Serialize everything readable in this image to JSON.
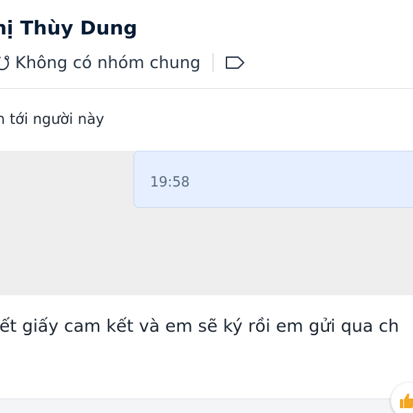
{
  "header": {
    "contact_name": "hị Thùy Dung",
    "group_status": "Không có nhóm chung",
    "group_icon": "group-circle-icon",
    "tag_icon": "tag-label-icon"
  },
  "banner": {
    "text": "n tới người này"
  },
  "chat": {
    "messages": [
      {
        "time": "19:58"
      }
    ]
  },
  "composer": {
    "draft_text": "iết giấy cam kết và em sẽ ký rồi em gửi qua ch"
  },
  "quick_reaction": {
    "icon": "thumbs-up-icon"
  },
  "colors": {
    "header_text": "#081c36",
    "bubble_bg": "#e5efff",
    "chat_bg": "#eeeeee",
    "like_accent": "#f5a623"
  }
}
